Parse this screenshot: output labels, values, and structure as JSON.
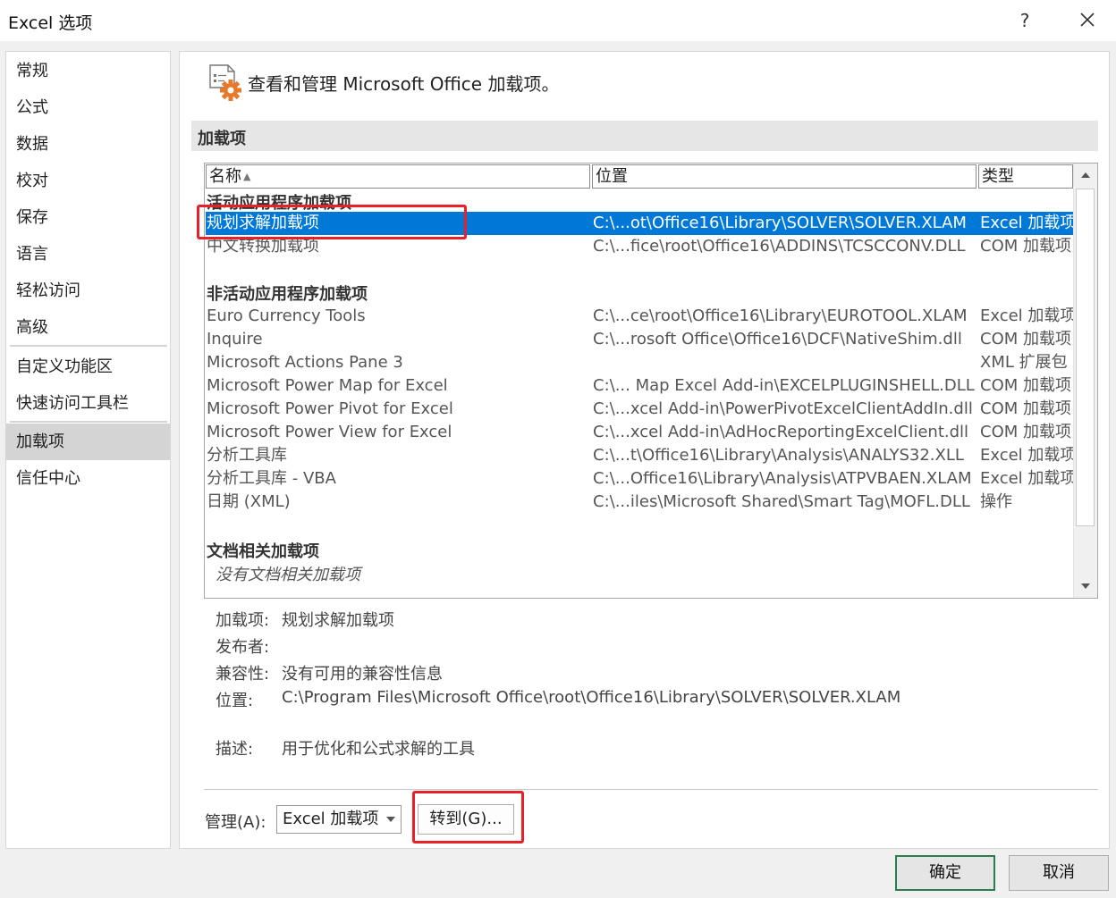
{
  "window": {
    "title": "Excel 选项",
    "help": "?"
  },
  "sidebar": {
    "items": [
      {
        "label": "常规"
      },
      {
        "label": "公式"
      },
      {
        "label": "数据"
      },
      {
        "label": "校对"
      },
      {
        "label": "保存"
      },
      {
        "label": "语言"
      },
      {
        "label": "轻松访问"
      },
      {
        "label": "高级"
      },
      {
        "label": "自定义功能区"
      },
      {
        "label": "快速访问工具栏"
      },
      {
        "label": "加载项"
      },
      {
        "label": "信任中心"
      }
    ],
    "selected": "加载项"
  },
  "header": {
    "text": "查看和管理 Microsoft Office 加载项。"
  },
  "section": {
    "title": "加载项"
  },
  "table": {
    "columns": [
      "名称",
      "位置",
      "类型"
    ],
    "groups": [
      {
        "label": "活动应用程序加载项",
        "rows": [
          {
            "name": "规划求解加载项",
            "location": "C:\\...ot\\Office16\\Library\\SOLVER\\SOLVER.XLAM",
            "type": "Excel 加载项"
          },
          {
            "name": "中文转换加载项",
            "location": "C:\\...fice\\root\\Office16\\ADDINS\\TCSCCONV.DLL",
            "type": "COM 加载项"
          }
        ]
      },
      {
        "label": "非活动应用程序加载项",
        "rows": [
          {
            "name": "Euro Currency Tools",
            "location": "C:\\...ce\\root\\Office16\\Library\\EUROTOOL.XLAM",
            "type": "Excel 加载项"
          },
          {
            "name": "Inquire",
            "location": "C:\\...rosoft Office\\Office16\\DCF\\NativeShim.dll",
            "type": "COM 加载项"
          },
          {
            "name": "Microsoft Actions Pane 3",
            "location": "",
            "type": "XML 扩展包"
          },
          {
            "name": "Microsoft Power Map for Excel",
            "location": "C:\\... Map Excel Add-in\\EXCELPLUGINSHELL.DLL",
            "type": "COM 加载项"
          },
          {
            "name": "Microsoft Power Pivot for Excel",
            "location": "C:\\...xcel Add-in\\PowerPivotExcelClientAddIn.dll",
            "type": "COM 加载项"
          },
          {
            "name": "Microsoft Power View for Excel",
            "location": "C:\\...xcel Add-in\\AdHocReportingExcelClient.dll",
            "type": "COM 加载项"
          },
          {
            "name": "分析工具库",
            "location": "C:\\...t\\Office16\\Library\\Analysis\\ANALYS32.XLL",
            "type": "Excel 加载项"
          },
          {
            "name": "分析工具库 - VBA",
            "location": "C:\\...Office16\\Library\\Analysis\\ATPVBAEN.XLAM",
            "type": "Excel 加载项"
          },
          {
            "name": "日期 (XML)",
            "location": "C:\\...iles\\Microsoft Shared\\Smart Tag\\MOFL.DLL",
            "type": "操作"
          }
        ]
      },
      {
        "label": "文档相关加载项",
        "empty": "没有文档相关加载项"
      }
    ]
  },
  "details": {
    "addin_label": "加载项:",
    "addin_value": "规划求解加载项",
    "publisher_label": "发布者:",
    "publisher_value": "",
    "compat_label": "兼容性:",
    "compat_value": "没有可用的兼容性信息",
    "location_label": "位置:",
    "location_value": "C:\\Program Files\\Microsoft Office\\root\\Office16\\Library\\SOLVER\\SOLVER.XLAM",
    "desc_label": "描述:",
    "desc_value": "用于优化和公式求解的工具"
  },
  "footer": {
    "manage_label": "管理(A):",
    "manage_value": "Excel 加载项",
    "goto_label": "转到(G)..."
  },
  "buttons": {
    "ok": "确定",
    "cancel": "取消"
  },
  "colors": {
    "selection": "#0078d7",
    "highlight": "#e8202a",
    "default_button_border": "#2d7b50"
  }
}
